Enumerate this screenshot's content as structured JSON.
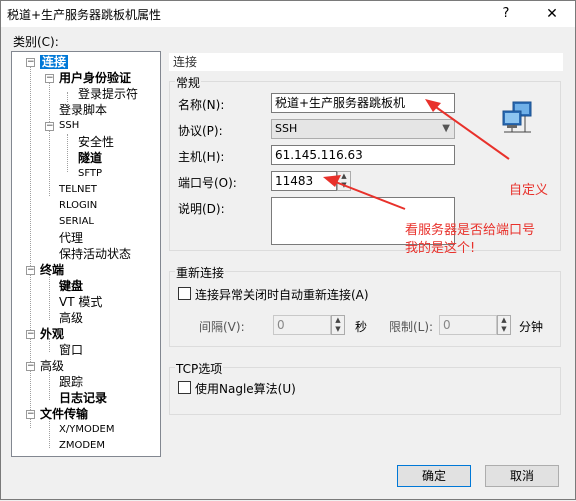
{
  "window": {
    "title": "税道+生产服务器跳板机属性",
    "help": "?",
    "close": "✕"
  },
  "category_label": "类别(C):",
  "tree": {
    "connection": "连接",
    "user_auth": "用户身份验证",
    "login_prompt": "登录提示符",
    "login_script": "登录脚本",
    "ssh": "SSH",
    "security": "安全性",
    "tunnel": "隧道",
    "sftp": "SFTP",
    "telnet": "TELNET",
    "rlogin": "RLOGIN",
    "serial": "SERIAL",
    "proxy": "代理",
    "keepalive": "保持活动状态",
    "terminal": "终端",
    "keyboard": "键盘",
    "vt_mode": "VT 模式",
    "term_advanced": "高级",
    "appearance": "外观",
    "window_item": "窗口",
    "advanced": "高级",
    "trace": "跟踪",
    "log": "日志记录",
    "file_transfer": "文件传输",
    "xymodem": "X/YMODEM",
    "zmodem": "ZMODEM"
  },
  "panel": {
    "title": "连接",
    "general": {
      "group": "常规",
      "name_label": "名称(N):",
      "name_value": "税道+生产服务器跳板机",
      "protocol_label": "协议(P):",
      "protocol_value": "SSH",
      "host_label": "主机(H):",
      "host_value": "61.145.116.63",
      "port_label": "端口号(O):",
      "port_value": "11483",
      "desc_label": "说明(D):",
      "desc_value": ""
    },
    "reconnect": {
      "group": "重新连接",
      "auto_label": "连接异常关闭时自动重新连接(A)",
      "auto_checked": false,
      "interval_label": "间隔(V):",
      "interval_value": "0",
      "interval_unit": "秒",
      "limit_label": "限制(L):",
      "limit_value": "0",
      "limit_unit": "分钟"
    },
    "tcp": {
      "group": "TCP选项",
      "nagle_label": "使用Nagle算法(U)",
      "nagle_checked": false
    }
  },
  "annotations": {
    "custom": "自定义",
    "port_note_1": "看服务器是否给端口号",
    "port_note_2": "我的是这个!"
  },
  "buttons": {
    "ok": "确定",
    "cancel": "取消"
  },
  "colors": {
    "selection": "#0078d7",
    "annotation": "#e8312b"
  },
  "icons": {
    "net": "network-computers-icon"
  }
}
